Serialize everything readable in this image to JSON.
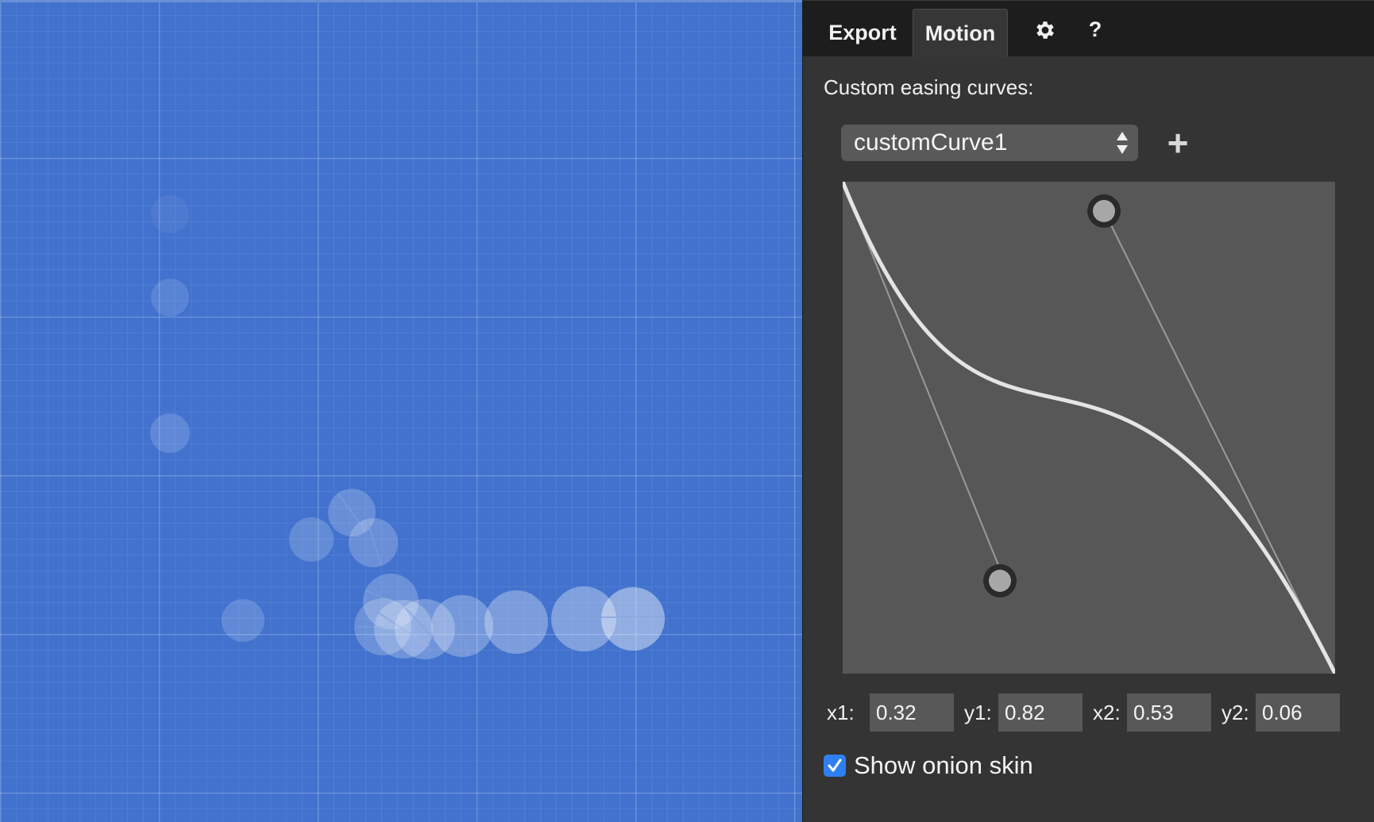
{
  "tabs": {
    "export_label": "Export",
    "motion_label": "Motion",
    "settings_icon": "gear-icon",
    "help_label": "?"
  },
  "easing": {
    "heading": "Custom easing curves:",
    "selected_curve": "customCurve1",
    "add_icon": "plus-icon",
    "params": {
      "x1_label": "x1:",
      "x1": "0.32",
      "y1_label": "y1:",
      "y1": "0.82",
      "x2_label": "x2:",
      "x2": "0.53",
      "y2_label": "y2:",
      "y2": "0.06"
    }
  },
  "onion_skin": {
    "label": "Show onion skin",
    "checked": true
  },
  "colors": {
    "stage_bg": "#4272ce",
    "panel_bg": "#343434",
    "tabbar_bg": "#1d1d1d",
    "curve_bg": "#575757",
    "checkbox_accent": "#2f7ff0"
  }
}
